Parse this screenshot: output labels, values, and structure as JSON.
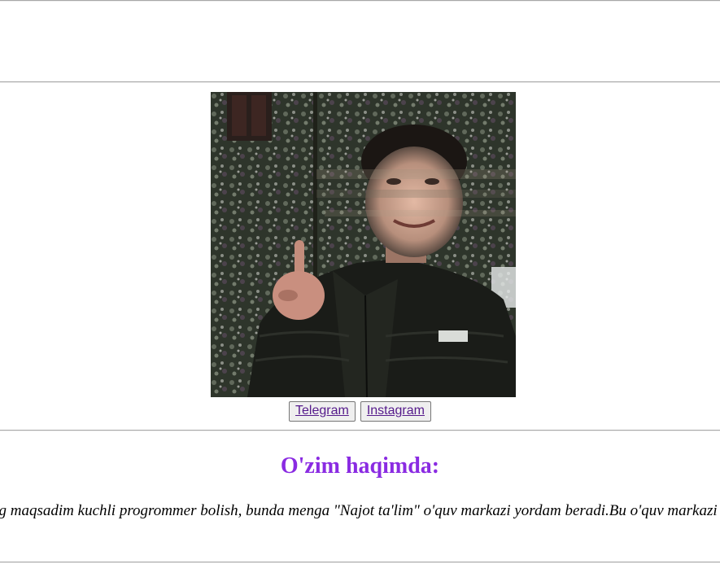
{
  "links": {
    "telegram_label": "Telegram",
    "instagram_label": "Instagram"
  },
  "about": {
    "title": "O'zim haqimda:",
    "marquee_text": "Mening maqsadim kuchli progrommer bolish, bunda menga \"Najot ta'lim\" o'quv markazi yordam beradi.Bu o'quv markazi"
  },
  "colors": {
    "title": "#8a2be2",
    "link": "#551a8b",
    "rule": "#a8a8a8"
  },
  "profile_photo": {
    "icon": "profile-photo"
  }
}
